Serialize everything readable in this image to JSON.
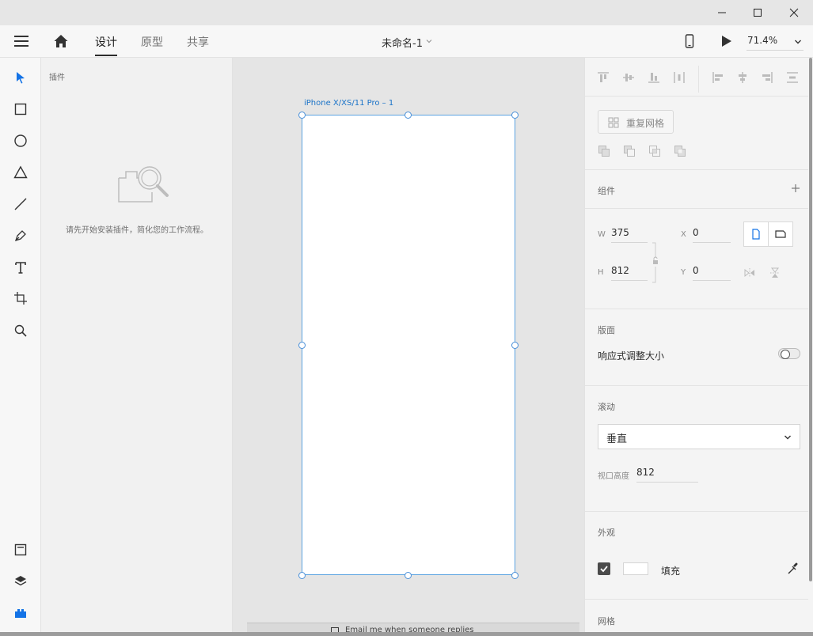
{
  "window": {
    "controls": [
      "minimize-icon",
      "maximize-icon",
      "close-icon"
    ]
  },
  "header": {
    "tabs": [
      {
        "label": "设计",
        "active": true
      },
      {
        "label": "原型",
        "active": false
      },
      {
        "label": "共享",
        "active": false
      }
    ],
    "doc_name": "未命名-1",
    "zoom": "71.4%"
  },
  "tools": [
    "select-tool-icon",
    "rectangle-tool-icon",
    "ellipse-tool-icon",
    "polygon-tool-icon",
    "line-tool-icon",
    "pen-tool-icon",
    "text-tool-icon",
    "artboard-tool-icon",
    "zoom-tool-icon"
  ],
  "rail_bottom": [
    "document-assets-icon",
    "layers-icon",
    "plugins-icon"
  ],
  "plugins": {
    "title": "插件",
    "empty_message": "请先开始安装插件，简化您的工作流程。"
  },
  "canvas": {
    "artboard_label": "iPhone X/XS/11 Pro – 1",
    "background_text": "Email me when someone replies"
  },
  "inspector": {
    "repeat_grid": "重复网格",
    "components_label": "组件",
    "w_label": "W",
    "w_value": "375",
    "h_label": "H",
    "h_value": "812",
    "x_label": "X",
    "x_value": "0",
    "y_label": "Y",
    "y_value": "0",
    "artboard_section": "版面",
    "responsive_resize": "响应式调整大小",
    "responsive_on": false,
    "scroll_section": "滚动",
    "scroll_option": "垂直",
    "viewport_label": "视口高度",
    "viewport_value": "812",
    "appearance_section": "外观",
    "fill_label": "填充",
    "fill_checked": true,
    "fill_color": "#ffffff",
    "grid_section": "网格"
  },
  "colors": {
    "accent": "#1a73c8",
    "artboard_border": "#5aa2e0",
    "select_tool": "#1473e6"
  }
}
